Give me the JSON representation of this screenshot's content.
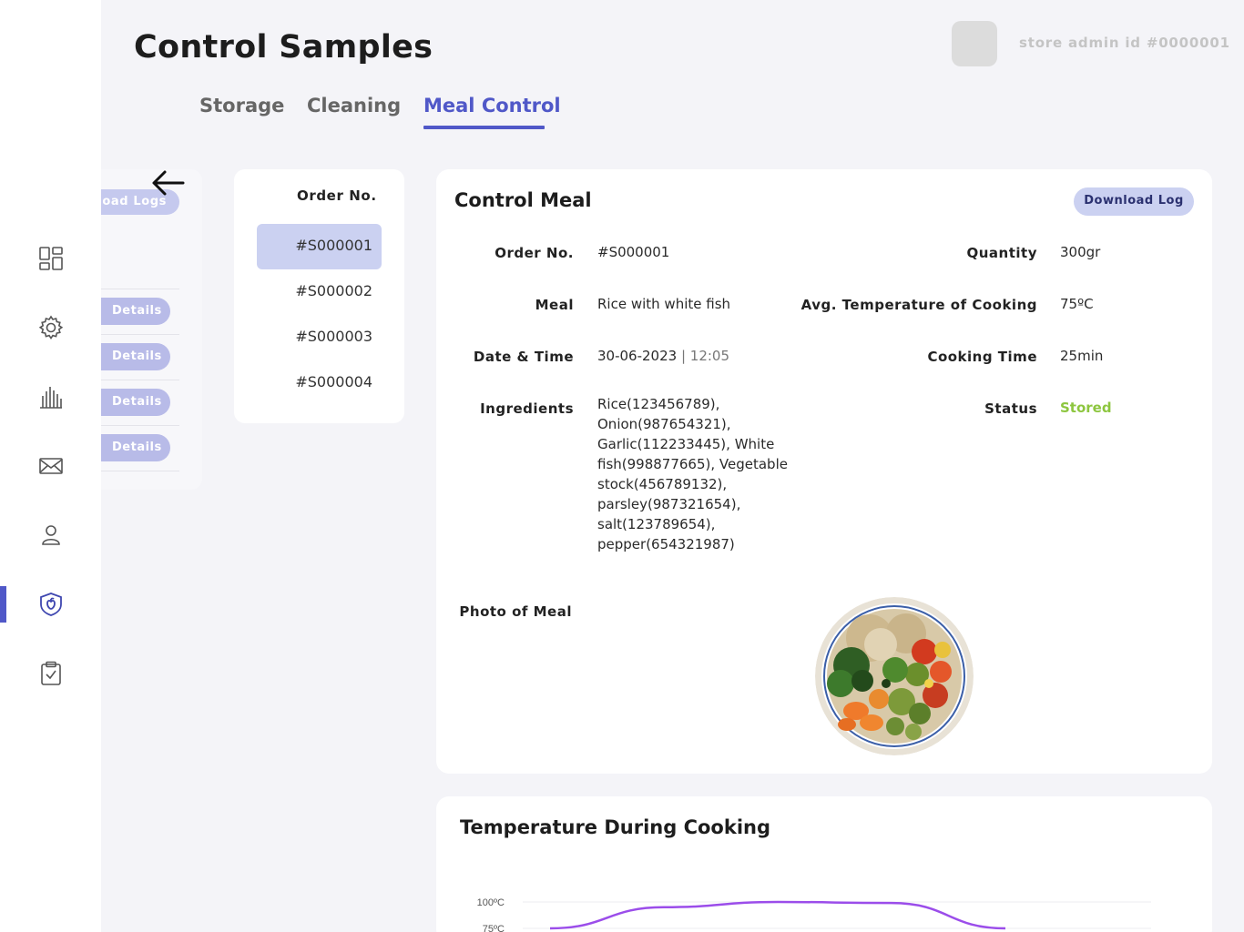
{
  "header": {
    "title": "Control Samples",
    "admin_id": "store admin id #0000001"
  },
  "tabs": [
    {
      "label": "Storage",
      "active": false
    },
    {
      "label": "Cleaning",
      "active": false
    },
    {
      "label": "Meal Control",
      "active": true
    }
  ],
  "sidebar": {
    "items": [
      {
        "icon": "dashboard-icon"
      },
      {
        "icon": "gear-icon"
      },
      {
        "icon": "bar-chart-icon"
      },
      {
        "icon": "mail-icon"
      },
      {
        "icon": "user-icon"
      },
      {
        "icon": "shield-icon",
        "active": true
      },
      {
        "icon": "clipboard-check-icon"
      }
    ]
  },
  "logs_panel": {
    "download_logs_label": "Download Logs",
    "details_label": "Details"
  },
  "orders": {
    "heading": "Order No.",
    "items": [
      "#S000001",
      "#S000002",
      "#S000003",
      "#S000004"
    ],
    "selected": "#S000001"
  },
  "meal": {
    "title": "Control Meal",
    "download_label": "Download Log",
    "labels": {
      "order_no": "Order No.",
      "meal": "Meal",
      "date_time": "Date & Time",
      "ingredients": "Ingredients",
      "photo": "Photo of Meal",
      "quantity": "Quantity",
      "avg_temp": "Avg. Temperature of Cooking",
      "cooking_time": "Cooking Time",
      "status": "Status"
    },
    "values": {
      "order_no": "#S000001",
      "meal": "Rice with white fish",
      "date": "30-06-2023",
      "time": "12:05",
      "ingredients": "Rice(123456789), Onion(987654321), Garlic(112233445), White fish(998877665), Vegetable stock(456789132), parsley(987321654), salt(123789654), pepper(654321987)",
      "quantity": "300gr",
      "avg_temp": "75ºC",
      "cooking_time": "25min",
      "status": "Stored"
    },
    "status_color": "#8dc63f"
  },
  "chart": {
    "title": "Temperature During Cooking"
  },
  "chart_data": {
    "type": "line",
    "title": "Temperature During Cooking",
    "y_tick_labels": [
      "100ºC",
      "75ºC"
    ],
    "series": [
      {
        "values": [
          75,
          95,
          100,
          99,
          75
        ],
        "color": "#9b4dea"
      }
    ]
  }
}
